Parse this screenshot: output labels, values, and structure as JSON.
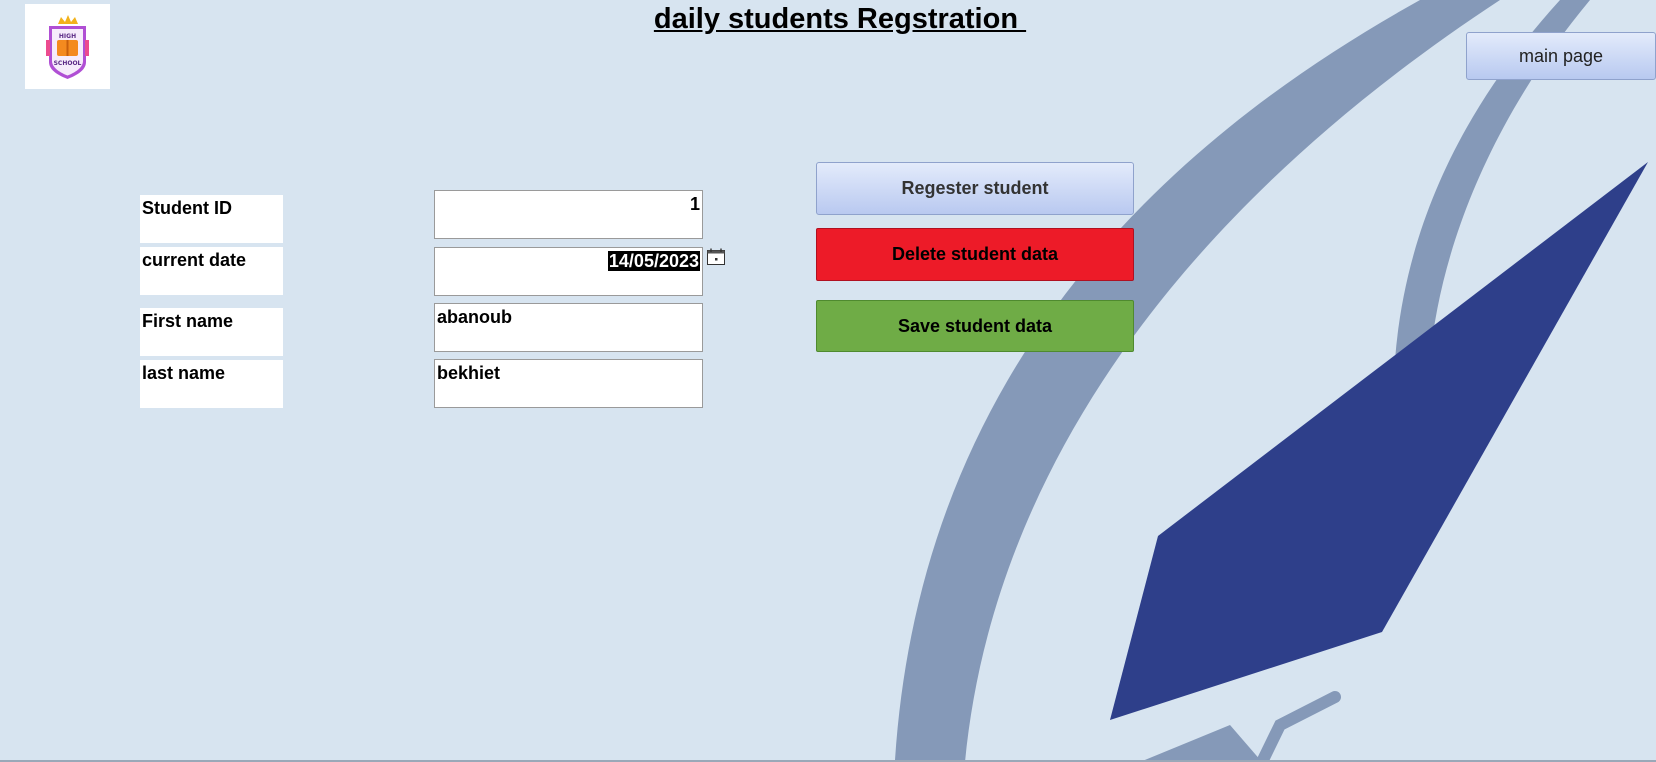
{
  "page": {
    "title": "daily students Regstration ",
    "main_page_button": "main page",
    "logo": {
      "icon": "school-shield-logo",
      "text_line1": "HIGH",
      "text_line2": "SCHOOL"
    }
  },
  "form": {
    "fields": [
      {
        "label": "Student ID",
        "value": "1"
      },
      {
        "label": "current date",
        "value": "14/05/2023"
      },
      {
        "label": "First name",
        "value": "abanoub"
      },
      {
        "label": "last name",
        "value": "bekhiet"
      }
    ],
    "calendar_icon": "calendar-icon"
  },
  "actions": {
    "register": "Regester student",
    "delete": "Delete student data",
    "save": "Save student data"
  },
  "colors": {
    "background": "#d7e4f0",
    "delete_button": "#ed1b28",
    "save_button": "#6fac46",
    "register_button": "#c9d7f4",
    "swoosh_light": "#8599b8",
    "swoosh_dark": "#2e3f8a"
  }
}
